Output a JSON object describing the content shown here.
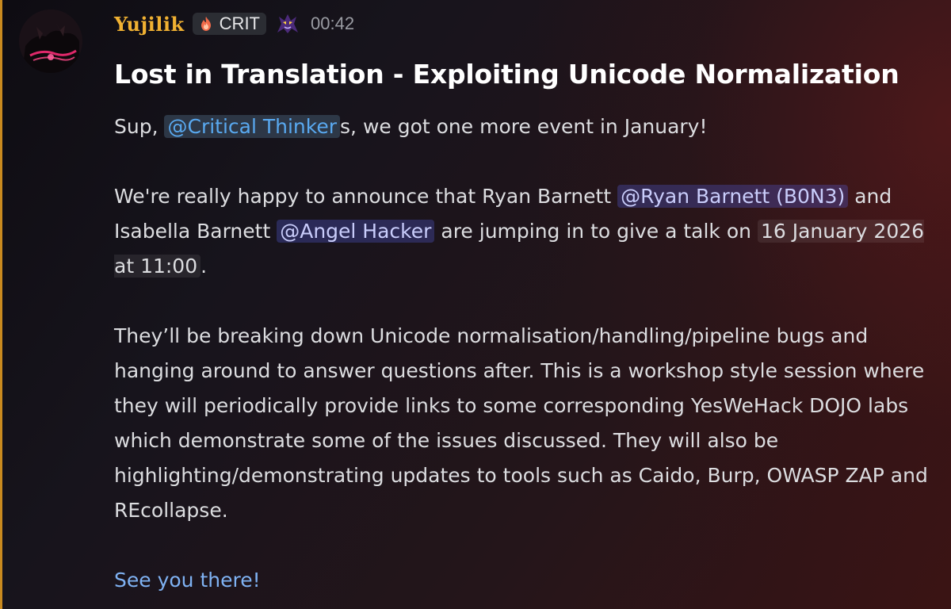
{
  "author": {
    "name": "Yujilik",
    "role_badge": "CRIT",
    "time": "00:42"
  },
  "message": {
    "title": "Lost in Translation - Exploiting Unicode Normalization",
    "greeting": {
      "before": "Sup, ",
      "role_mention": "@Critical Thinker",
      "after": "s, we got one more event in January!"
    },
    "announcement": {
      "part1": "We're really happy to announce that Ryan Barnett ",
      "mention1": "@Ryan Barnett (B0N3)",
      "part2": " and Isabella Barnett ",
      "mention2": "@Angel Hacker",
      "part3": " are jumping in to give a talk on ",
      "date": "16 January 2026 at 11:00",
      "part4": "."
    },
    "details": "They’ll be breaking down Unicode normalisation/handling/pipeline bugs and hanging around to answer questions after. This is a workshop style session where they will periodically provide links to some corresponding YesWeHack DOJO labs which demonstrate some of the issues discussed. They will also be highlighting/demonstrating updates to tools such as Caido, Burp, OWASP ZAP and REcollapse.",
    "signoff": "See you there!"
  },
  "icons": {
    "avatar": "user-avatar",
    "role": "flame-icon",
    "server_tag": "purple-creature-icon"
  },
  "colors": {
    "username": "#f0b132",
    "role_mention_text": "#59a9f0",
    "user_mention_bg": "#5865f2",
    "link": "#7fb2f3",
    "accent_rail": "#c98a1f"
  }
}
